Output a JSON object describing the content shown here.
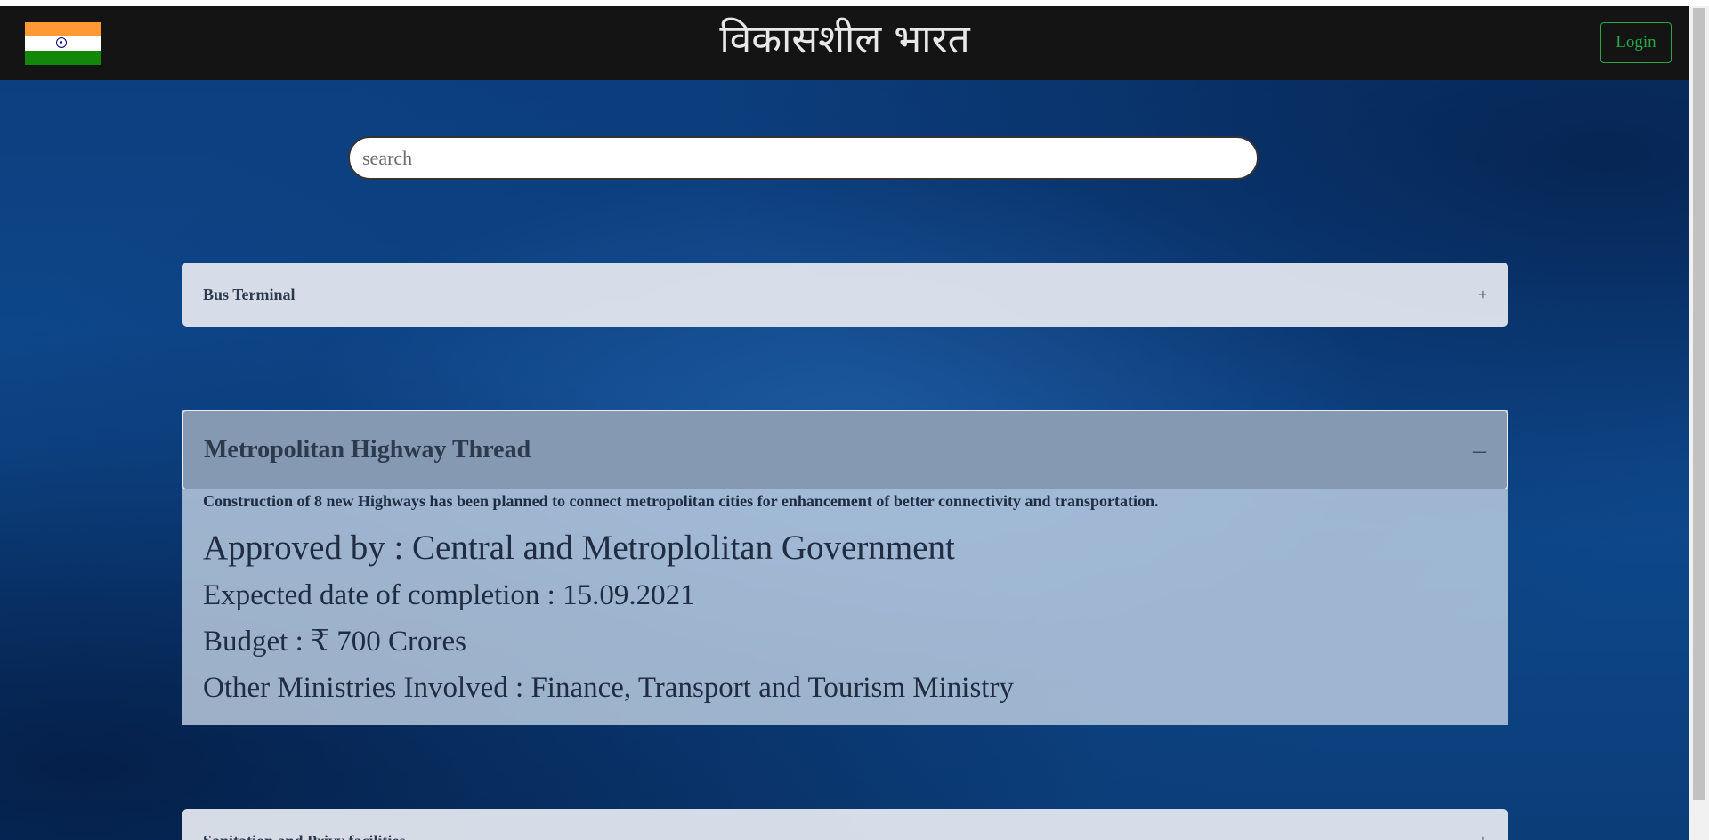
{
  "header": {
    "brand": "विकासशील भारत",
    "login_label": "Login"
  },
  "search": {
    "placeholder": "search"
  },
  "projects": [
    {
      "title": "Bus Terminal",
      "toggle": "+"
    },
    {
      "title": "Metropolitan Highway Thread",
      "toggle": "–",
      "description": "Construction of 8 new Highways has been planned to connect metropolitan cities for enhancement of better connectivity and transportation.",
      "approved_by": "Approved by : Central and Metroplolitan Government",
      "completion": "Expected date of completion : 15.09.2021",
      "budget": "Budget : ₹ 700 Crores",
      "ministries": "Other Ministries Involved : Finance, Transport and Tourism Ministry"
    },
    {
      "title": "Sanitation and Privy facilities",
      "toggle": "+"
    }
  ],
  "colors": {
    "navbar_bg": "#141414",
    "login_accent": "#28a745",
    "hero_bg": "#0e4a8f"
  },
  "icons": {
    "flag": "india-flag-icon"
  }
}
